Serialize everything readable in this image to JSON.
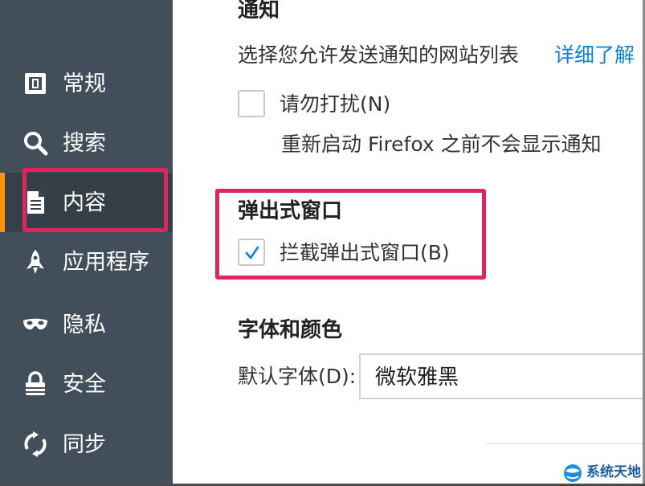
{
  "sidebar": {
    "items": [
      {
        "label": "常规",
        "icon": "general-icon"
      },
      {
        "label": "搜索",
        "icon": "search-icon"
      },
      {
        "label": "内容",
        "icon": "document-icon",
        "selected": true
      },
      {
        "label": "应用程序",
        "icon": "rocket-icon"
      },
      {
        "label": "隐私",
        "icon": "mask-icon"
      },
      {
        "label": "安全",
        "icon": "lock-icon"
      },
      {
        "label": "同步",
        "icon": "sync-icon"
      }
    ]
  },
  "notifications": {
    "heading": "通知",
    "description": "选择您允许发送通知的网站列表",
    "learn_more": "详细了解",
    "dnd_label": "请勿打扰(N)",
    "dnd_note": "重新启动 Firefox 之前不会显示通知"
  },
  "popups": {
    "heading": "弹出式窗口",
    "block_label": "拦截弹出式窗口(B)",
    "checked": true
  },
  "fonts": {
    "heading": "字体和颜色",
    "default_font_label": "默认字体(D):",
    "default_font_value": "微软雅黑"
  },
  "watermark": {
    "text": "系统天地"
  },
  "colors": {
    "sidebar_bg": "#424f5a",
    "selected_bg": "#343f48",
    "accent": "#ff9400",
    "highlight": "#e0245e",
    "link": "#0a84d6"
  }
}
